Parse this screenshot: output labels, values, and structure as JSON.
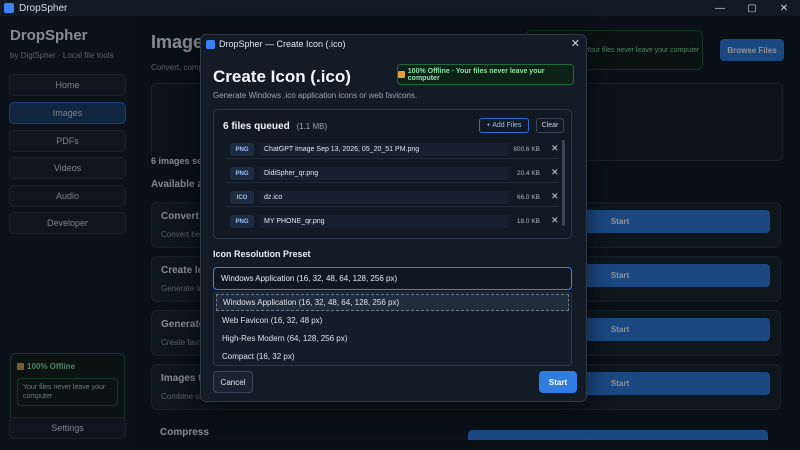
{
  "app": {
    "window_title": "DropSpher",
    "controls": [
      "—",
      "▢",
      "✕"
    ]
  },
  "sidebar": {
    "brand": "DropSpher",
    "tagline": "by DigiSpher · Local file tools",
    "items": [
      {
        "label": "Home",
        "active": false
      },
      {
        "label": "Images",
        "active": true
      },
      {
        "label": "PDFs",
        "active": false
      },
      {
        "label": "Videos",
        "active": false
      },
      {
        "label": "Audio",
        "active": false
      },
      {
        "label": "Developer",
        "active": false
      }
    ],
    "offline_title": "100% Offline",
    "offline_text": "Your files never leave your computer",
    "settings_label": "Settings"
  },
  "main": {
    "title": "Images",
    "subtitle": "Convert, comp",
    "badge_text": "Your files never leave your computer",
    "browse_label": "Browse Files",
    "selected_count": "6 images sele",
    "available_heading": "Available ac",
    "cards": [
      {
        "title": "Convert f",
        "desc": "Convert bet",
        "start": "Start"
      },
      {
        "title": "Create Ic",
        "desc": "Generate W",
        "start": "Start"
      },
      {
        "title": "Generate",
        "desc": "Create favic",
        "start": "Start"
      },
      {
        "title": "Images to",
        "desc": "Combine or",
        "start": "Start"
      }
    ],
    "compress_title": "Compress"
  },
  "modal": {
    "window_title": "DropSpher — Create Icon (.ico)",
    "heading": "Create Icon (.ico)",
    "badge": "100% Offline · Your files never leave your computer",
    "description": "Generate Windows .ico application icons or web favicons.",
    "queue": {
      "title": "6 files queued",
      "size": "(1.1 MB)",
      "add_label": "+ Add Files",
      "clear_label": "Clear",
      "files": [
        {
          "type": "PNG",
          "name": "ChatGPT Image Sep 13, 2026, 05_20_51 PM.png",
          "size": "800.6 KB"
        },
        {
          "type": "PNG",
          "name": "DidiSpher_qr.png",
          "size": "20.4 KB"
        },
        {
          "type": "ICO",
          "name": "dz.ico",
          "size": "66.0 KB"
        },
        {
          "type": "PNG",
          "name": "MY PHONE_qr.png",
          "size": "18.0 KB"
        }
      ]
    },
    "preset_label": "Icon Resolution Preset",
    "preset_value": "Windows Application (16, 32, 48, 64, 128, 256 px)",
    "options": [
      "Windows Application (16, 32, 48, 64, 128, 256 px)",
      "Web Favicon (16, 32, 48 px)",
      "High-Res Modern (64, 128, 256 px)",
      "Compact (16, 32 px)"
    ],
    "cancel_label": "Cancel",
    "start_label": "Start"
  }
}
